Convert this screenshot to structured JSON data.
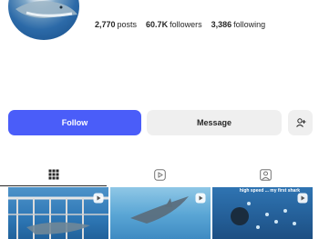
{
  "profile": {
    "posts_count": "2,770",
    "posts_label": "posts",
    "followers_count": "60.7K",
    "followers_label": "followers",
    "following_count": "3,386",
    "following_label": "following"
  },
  "actions": {
    "follow_label": "Follow",
    "message_label": "Message",
    "suggest_icon": "person-add-icon"
  },
  "tabs": [
    {
      "icon": "grid-icon",
      "active": true
    },
    {
      "icon": "reels-icon",
      "active": false
    },
    {
      "icon": "tagged-icon",
      "active": false
    }
  ],
  "posts": [
    {
      "type": "reel"
    },
    {
      "type": "reel"
    },
    {
      "type": "reel",
      "caption": "high speed ... my first shark"
    }
  ],
  "colors": {
    "accent": "#4a5df9",
    "secondary_button": "#efefef",
    "text": "#262626"
  }
}
